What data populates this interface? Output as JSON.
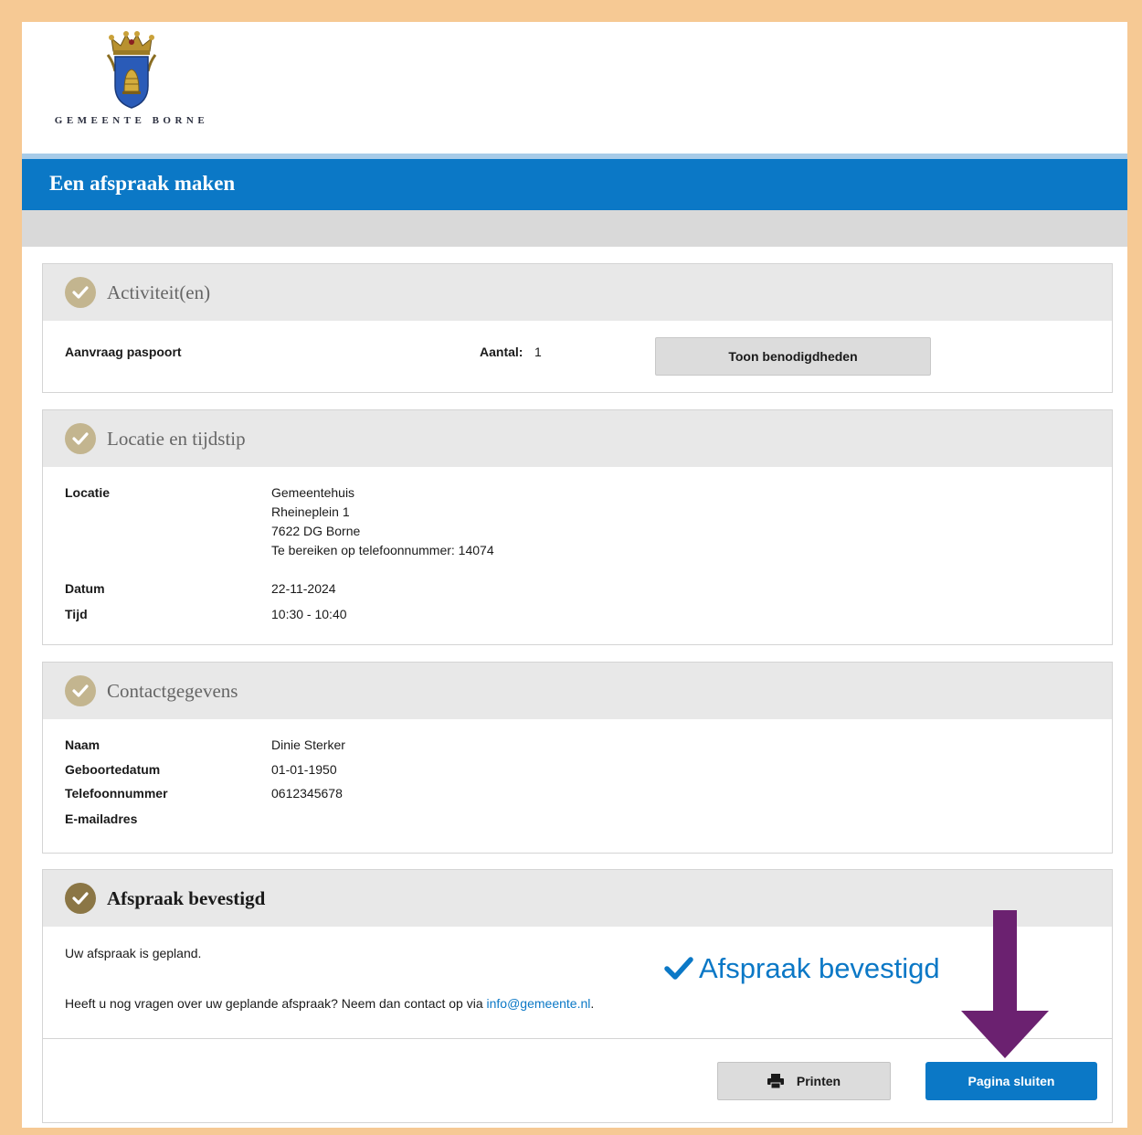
{
  "logo": {
    "text": "GEMEENTE BORNE",
    "icon": "coat-of-arms"
  },
  "header": {
    "title": "Een afspraak maken"
  },
  "sections": {
    "activiteiten": {
      "title": "Activiteit(en)",
      "activity": "Aanvraag paspoort",
      "aantal_label": "Aantal:",
      "aantal_value": "1",
      "button": "Toon benodigdheden"
    },
    "locatie": {
      "title": "Locatie en tijdstip",
      "locatie_label": "Locatie",
      "address_lines": [
        "Gemeentehuis",
        "Rheineplein 1",
        "7622 DG Borne",
        "Te bereiken op telefoonnummer: 14074"
      ],
      "datum_label": "Datum",
      "datum_value": "22-11-2024",
      "tijd_label": "Tijd",
      "tijd_value": "10:30 - 10:40"
    },
    "contact": {
      "title": "Contactgegevens",
      "naam_label": "Naam",
      "naam_value": "Dinie Sterker",
      "geboortedatum_label": "Geboortedatum",
      "geboortedatum_value": "01-01-1950",
      "telefoon_label": "Telefoonnummer",
      "telefoon_value": "0612345678",
      "email_label": "E-mailadres",
      "email_value": ""
    },
    "bevestigd": {
      "title": "Afspraak bevestigd",
      "message": "Uw afspraak is gepland.",
      "question": "Heeft u nog vragen over uw geplande afspraak? Neem dan contact op via",
      "email": "info@gemeente.nl",
      "period": ".",
      "confirm_text": "Afspraak bevestigd"
    }
  },
  "buttons": {
    "print": "Printen",
    "close": "Pagina sluiten"
  },
  "colors": {
    "brand_blue": "#0b78c6",
    "gold": "#c3b58f",
    "annotation_arrow": "#6b2170",
    "frame": "#f6c994"
  }
}
